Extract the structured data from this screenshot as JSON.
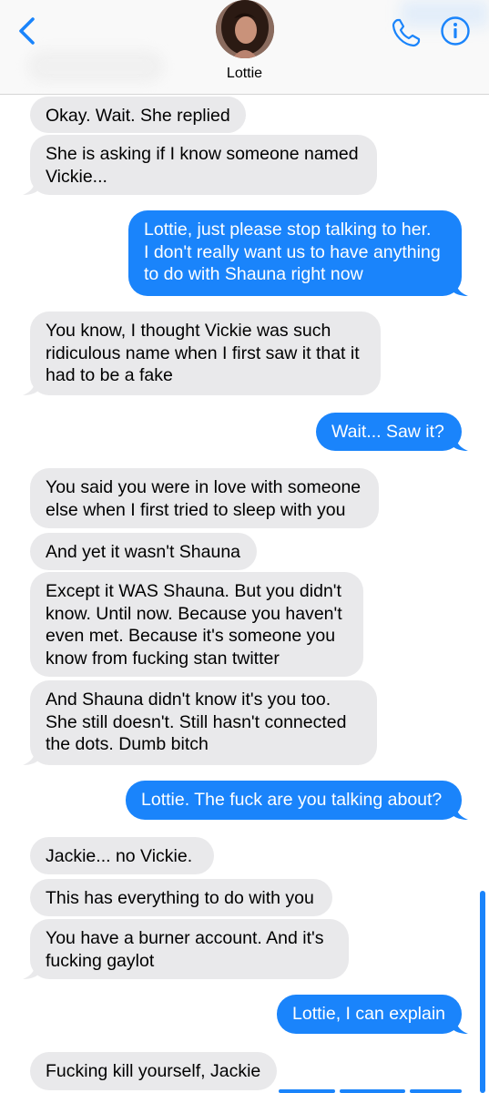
{
  "header": {
    "contact_name": "Lottie",
    "icons": {
      "back": "chevron-left-icon",
      "phone": "phone-icon",
      "info": "info-icon"
    },
    "accent_color": "#1a84fb"
  },
  "messages": [
    {
      "direction": "in",
      "text": "Okay. Wait. She replied"
    },
    {
      "direction": "in",
      "text": "She is asking if I know someone named\nVickie..."
    },
    {
      "direction": "out",
      "text": "Lottie, just please stop talking to her.\nI don't really want us to have anything\nto do with Shauna right now"
    },
    {
      "direction": "in",
      "text": "You know, I thought Vickie was such\nridiculous name when I first saw it that it\nhad to be a fake"
    },
    {
      "direction": "out",
      "text": "Wait... Saw it?"
    },
    {
      "direction": "in",
      "text": "You said you were in love with someone\nelse when I first tried to sleep with you"
    },
    {
      "direction": "in",
      "text": "And yet it wasn't Shauna"
    },
    {
      "direction": "in",
      "text": "Except it WAS Shauna. But you didn't\nknow. Until now. Because you haven't\neven met. Because it's someone you\nknow from fucking stan twitter"
    },
    {
      "direction": "in",
      "text": "And Shauna didn't know it's you too.\nShe still doesn't.  Still hasn't connected\nthe dots. Dumb bitch"
    },
    {
      "direction": "out",
      "text": "Lottie. The fuck are you talking about?"
    },
    {
      "direction": "in",
      "text": "Jackie... no Vickie."
    },
    {
      "direction": "in",
      "text": "This has everything to do with you"
    },
    {
      "direction": "in",
      "text": "You have a  burner account. And it's\nfucking gaylot"
    },
    {
      "direction": "out",
      "text": "Lottie, I can explain"
    },
    {
      "direction": "in",
      "text": "Fucking kill yourself, Jackie"
    }
  ]
}
